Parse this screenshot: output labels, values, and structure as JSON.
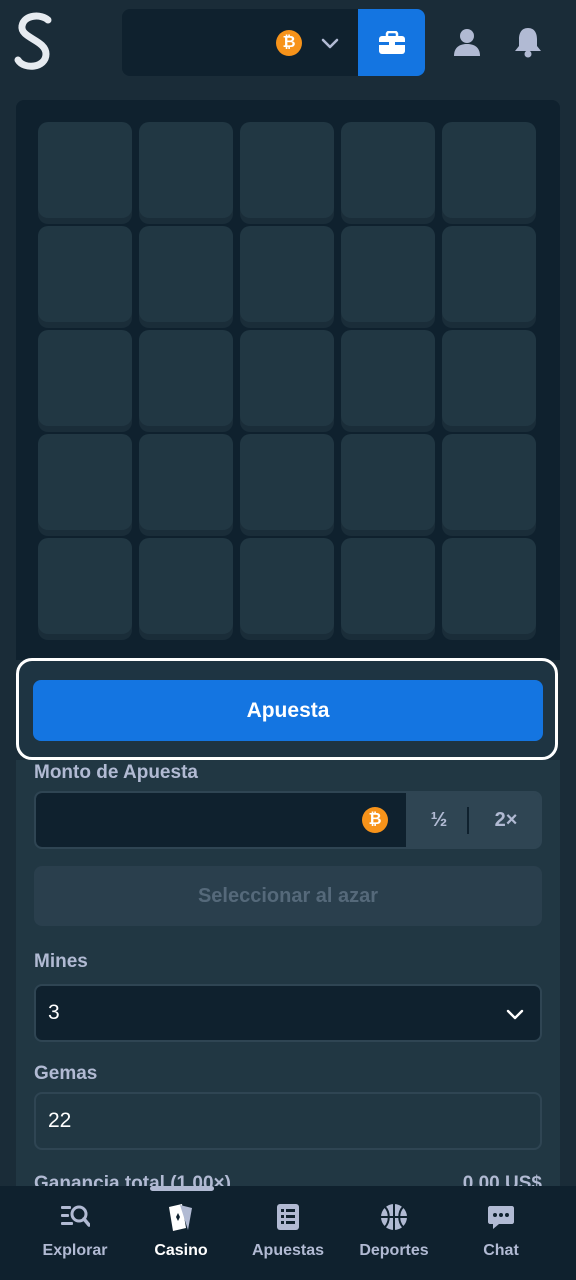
{
  "header": {
    "logo_letter": "S",
    "wallet": {
      "currency_icon": "bitcoin-icon",
      "currency_symbol": "₿",
      "dropdown_icon": "chevron-down-icon",
      "wallet_button_icon": "wallet-icon"
    },
    "profile_icon": "user-icon",
    "notifications_icon": "bell-icon"
  },
  "game": {
    "rows": 5,
    "columns": 5,
    "tiles_revealed": 0
  },
  "bet_button": {
    "label": "Apuesta"
  },
  "bet_amount": {
    "label": "Monto de Apuesta",
    "value": "",
    "currency_symbol": "₿",
    "half_label": "½",
    "double_label": "2×"
  },
  "random_button": {
    "label": "Seleccionar al azar"
  },
  "mines": {
    "label": "Mines",
    "value": "3"
  },
  "gems": {
    "label": "Gemas",
    "value": "22"
  },
  "profit": {
    "label": "Ganancia total (1,00×)",
    "value": "0,00 US$"
  },
  "bottom_nav": {
    "items": [
      {
        "label": "Explorar",
        "icon": "search-icon"
      },
      {
        "label": "Casino",
        "icon": "cards-icon",
        "active": true
      },
      {
        "label": "Apuestas",
        "icon": "bet-slip-icon"
      },
      {
        "label": "Deportes",
        "icon": "basketball-icon"
      },
      {
        "label": "Chat",
        "icon": "chat-icon"
      }
    ]
  },
  "colors": {
    "background": "#1a2c38",
    "panel": "#213743",
    "board": "#0f212e",
    "tile": "#213743",
    "accent_blue": "#1475e1",
    "bitcoin": "#f7931a",
    "text_muted": "#b1bad3"
  }
}
